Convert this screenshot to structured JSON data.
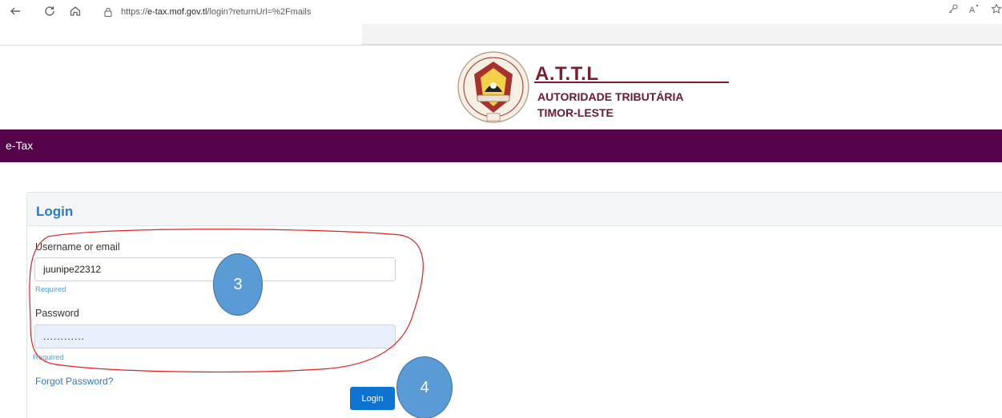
{
  "browser": {
    "url_prefix": "https://",
    "url_host": "e-tax.mof.gov.tl",
    "url_path": "/login?returnUrl=%2Fmails"
  },
  "header": {
    "title": "A.T.T.L",
    "subtitle_line1": "AUTORIDADE TRIBUTÁRIA",
    "subtitle_line2": "TIMOR-LESTE",
    "seal_text": "REPUBLICA DEMOCRATICA DE TIMOR-LESTE",
    "seal_motto": "UNIDADE ACÇÃO PROGRESSO",
    "seal_initials": "RDTL"
  },
  "navbar": {
    "brand": "e-Tax"
  },
  "login": {
    "title": "Login",
    "username_label": "Username or email",
    "username_value": "juunipe22312",
    "username_hint": "Required",
    "password_label": "Password",
    "password_value": "............",
    "password_hint": "Required",
    "forgot_label": "Forgot Password?",
    "submit_label": "Login"
  },
  "annotations": {
    "badge_1": "3",
    "badge_2": "4",
    "color": "#5b9bd5",
    "outline_color": "#e02020"
  },
  "colors": {
    "navbar": "#55024b",
    "accent": "#2b77c9",
    "button": "#0d74d2",
    "brand_red": "#7a1f2b"
  }
}
